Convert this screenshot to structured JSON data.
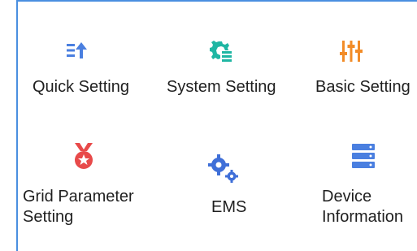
{
  "menu": {
    "items": [
      {
        "label": "Quick Setting",
        "icon": "quick-setting-icon",
        "color": "#4a7fe0"
      },
      {
        "label": "System Setting",
        "icon": "system-setting-icon",
        "color": "#1fb6a3"
      },
      {
        "label": "Basic Setting",
        "icon": "basic-setting-icon",
        "color": "#f28c28"
      },
      {
        "label": "Grid Parameter\nSetting",
        "icon": "grid-parameter-icon",
        "color": "#e84a4a"
      },
      {
        "label": "EMS",
        "icon": "ems-icon",
        "color": "#3f6fd8"
      },
      {
        "label": "Device\nInformation",
        "icon": "device-information-icon",
        "color": "#4a7fe0"
      }
    ]
  }
}
